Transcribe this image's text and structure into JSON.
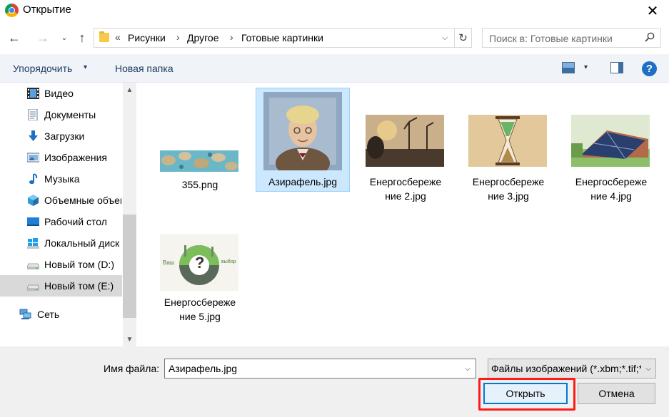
{
  "window": {
    "title": "Открытие",
    "close_glyph": "✕"
  },
  "nav": {
    "back_glyph": "←",
    "forward_glyph": "→",
    "recent_glyph": "⌄",
    "up_glyph": "↑"
  },
  "address": {
    "overflow_glyph": "«",
    "crumbs": [
      "Рисунки",
      "Другое",
      "Готовые картинки"
    ],
    "separator": "›",
    "dropdown_glyph": "⌵",
    "refresh_glyph": "↻"
  },
  "search": {
    "placeholder": "Поиск в: Готовые картинки"
  },
  "toolbar": {
    "organize_label": "Упорядочить",
    "organize_caret": "▾",
    "new_folder_label": "Новая папка",
    "view_caret": "▾",
    "help_glyph": "?"
  },
  "sidebar": {
    "items": [
      {
        "label": "Видео",
        "icon": "video-icon"
      },
      {
        "label": "Документы",
        "icon": "documents-icon"
      },
      {
        "label": "Загрузки",
        "icon": "downloads-icon"
      },
      {
        "label": "Изображения",
        "icon": "pictures-icon"
      },
      {
        "label": "Музыка",
        "icon": "music-icon"
      },
      {
        "label": "Объемные объекты",
        "icon": "3d-objects-icon"
      },
      {
        "label": "Рабочий стол",
        "icon": "desktop-icon"
      },
      {
        "label": "Локальный диск (C:)",
        "icon": "windows-drive-icon"
      },
      {
        "label": "Новый том (D:)",
        "icon": "drive-icon"
      },
      {
        "label": "Новый том (E:)",
        "icon": "drive-icon",
        "selected": true
      },
      {
        "label": "Сеть",
        "icon": "network-icon"
      }
    ],
    "scroll_up_glyph": "▲",
    "scroll_down_glyph": "▼"
  },
  "files": [
    {
      "name_line1": "355.png",
      "name_line2": "",
      "thumb": "map-thumbnail"
    },
    {
      "name_line1": "Азирафель.jpg",
      "name_line2": "",
      "thumb": "portrait-thumbnail",
      "selected": true
    },
    {
      "name_line1": "Енергосбереже",
      "name_line2": "ние 2.jpg",
      "thumb": "wind-turbines-thumbnail"
    },
    {
      "name_line1": "Енергосбереже",
      "name_line2": "ние 3.jpg",
      "thumb": "hourglass-thumbnail"
    },
    {
      "name_line1": "Енергосбереже",
      "name_line2": "ние 4.jpg",
      "thumb": "solar-panels-thumbnail"
    },
    {
      "name_line1": "Енергосбереже",
      "name_line2": "ние 5.jpg",
      "thumb": "energy-choice-thumbnail",
      "thumb_text_left": "Ваш",
      "thumb_text_right": "выбор"
    }
  ],
  "footer": {
    "filename_label": "Имя файла:",
    "filename_value": "Азирафель.jpg",
    "filename_dropdown_glyph": "⌵",
    "filetype_value": "Файлы изображений (*.xbm;*.tif;*.pjp;*.svgz;*.jpg;*.jpeg;*.ico;*.tiff;*.gif;*.svg;*.jfif;*.webp;*.png;*.bmp;*.pjpeg;*.avif)",
    "filetype_dropdown_glyph": "⌵",
    "open_label": "Открыть",
    "cancel_label": "Отмена"
  },
  "colors": {
    "selection_bg": "#cce8ff",
    "selection_border": "#99d1ff",
    "accent": "#0078d7",
    "highlight": "#ff1a1a"
  }
}
